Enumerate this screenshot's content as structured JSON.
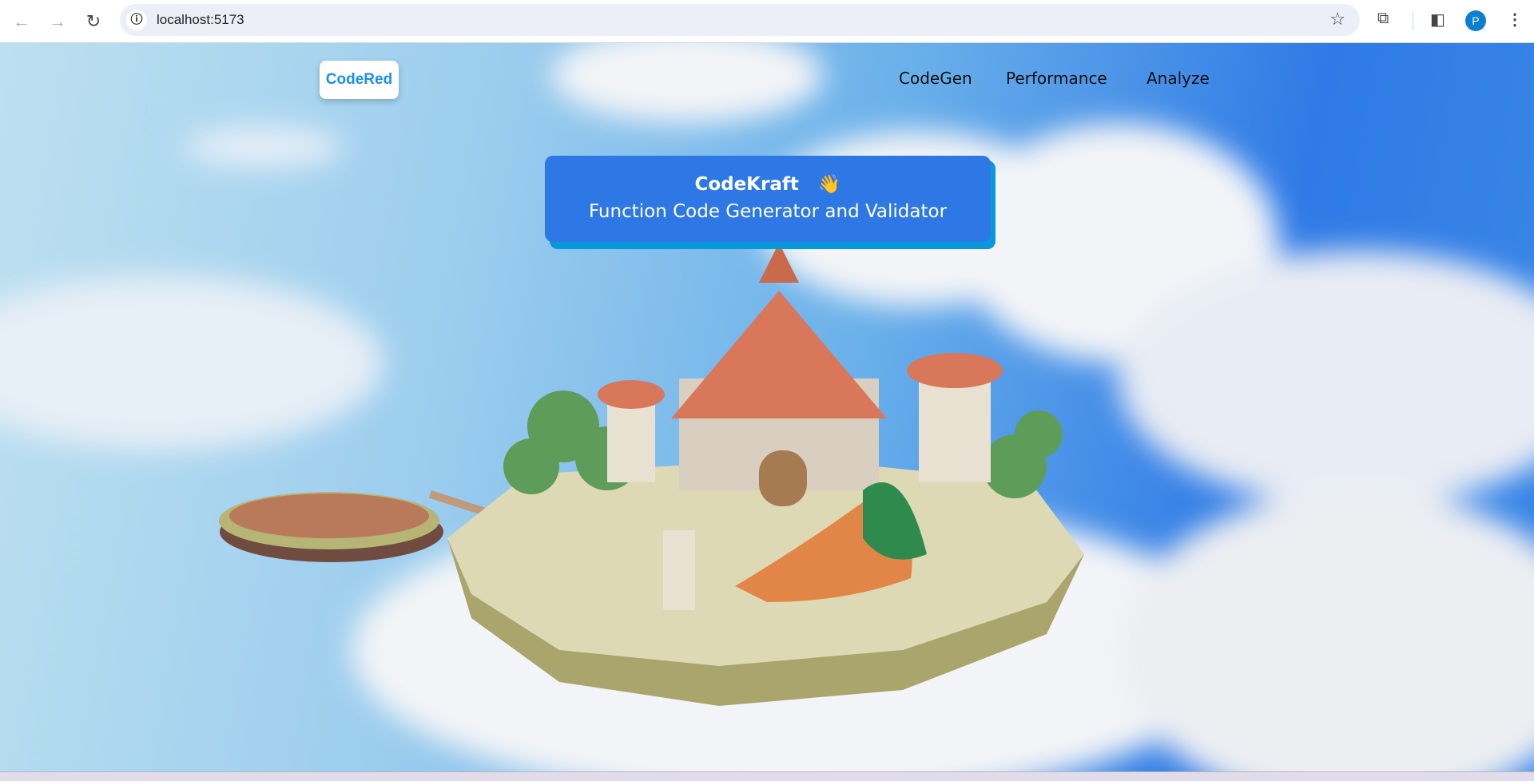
{
  "browser": {
    "url": "localhost:5173",
    "profile_initial": "P"
  },
  "header": {
    "logo": "CodeRed",
    "nav": [
      {
        "label": "CodeGen"
      },
      {
        "label": "Performance"
      },
      {
        "label": "Analyze"
      }
    ]
  },
  "hero": {
    "title": "CodeKraft",
    "emoji": "👋",
    "subtitle": "Function Code Generator and Validator"
  },
  "colors": {
    "banner": "#2e78e6",
    "banner_shadow": "#0a98dc",
    "logo_text": "#1a8ff0"
  }
}
